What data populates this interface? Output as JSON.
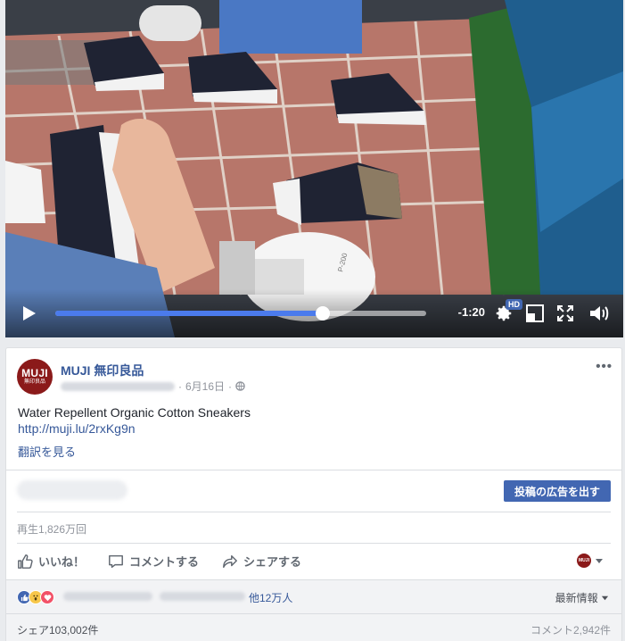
{
  "video": {
    "time_remaining": "-1:20",
    "progress_fraction": 0.72,
    "hd_label": "HD",
    "box_label": "P-200"
  },
  "post": {
    "page_name": "MUJI 無印良品",
    "avatar_text_1": "MUJI",
    "avatar_text_2": "無印良品",
    "date": "6月16日",
    "text": "Water Repellent Organic Cotton Sneakers",
    "link": "http://muji.lu/2rxKg9n",
    "translate_label": "翻訳を見る",
    "boost_button": "投稿の広告を出す",
    "views": "再生1,826万回",
    "mini_avatar_text": "MUJI"
  },
  "actions": {
    "like": "いいね！",
    "comment": "コメントする",
    "share": "シェアする"
  },
  "reactions": {
    "others": "他12万人",
    "sort_label": "最新情報"
  },
  "footer": {
    "shares": "シェア103,002件",
    "comments": "コメント2,942件"
  },
  "colors": {
    "brand_blue": "#4267b2",
    "link_blue": "#365899",
    "muji_red": "#8b1a1a",
    "progress_blue": "#4b7bec"
  }
}
